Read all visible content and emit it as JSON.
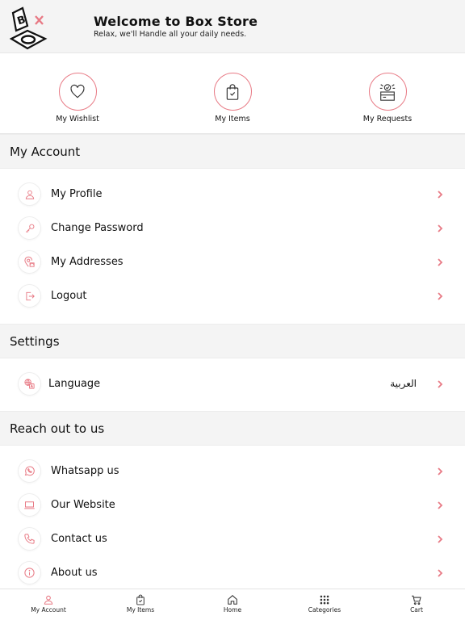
{
  "header": {
    "title": "Welcome to Box Store",
    "subtitle": "Relax, we'll Handle all your daily needs."
  },
  "quick_actions": [
    {
      "label": "My Wishlist",
      "icon": "heart-icon"
    },
    {
      "label": "My Items",
      "icon": "shopping-bag-check-icon"
    },
    {
      "label": "My Requests",
      "icon": "box-request-icon"
    }
  ],
  "sections": {
    "account": {
      "title": "My Account",
      "items": [
        {
          "label": "My Profile",
          "icon": "user-icon"
        },
        {
          "label": "Change Password",
          "icon": "key-icon"
        },
        {
          "label": "My Addresses",
          "icon": "address-pin-icon"
        },
        {
          "label": "Logout",
          "icon": "logout-icon"
        }
      ]
    },
    "settings": {
      "title": "Settings",
      "items": [
        {
          "label": "Language",
          "value": "العربية",
          "icon": "language-icon"
        }
      ]
    },
    "reach": {
      "title": "Reach out to us",
      "items": [
        {
          "label": "Whatsapp us",
          "icon": "whatsapp-icon"
        },
        {
          "label": "Our Website",
          "icon": "laptop-icon"
        },
        {
          "label": "Contact us",
          "icon": "phone-icon"
        },
        {
          "label": "About us",
          "icon": "info-icon"
        }
      ]
    }
  },
  "bottom_nav": [
    {
      "label": "My Account",
      "icon": "user-icon",
      "active": true
    },
    {
      "label": "My Items",
      "icon": "shopping-bag-check-icon"
    },
    {
      "label": "Home",
      "icon": "home-icon"
    },
    {
      "label": "Categories",
      "icon": "grid-icon"
    },
    {
      "label": "Cart",
      "icon": "cart-icon"
    }
  ],
  "colors": {
    "accent": "#e87a85",
    "header_bg": "#f4f4f4",
    "text": "#111111"
  }
}
